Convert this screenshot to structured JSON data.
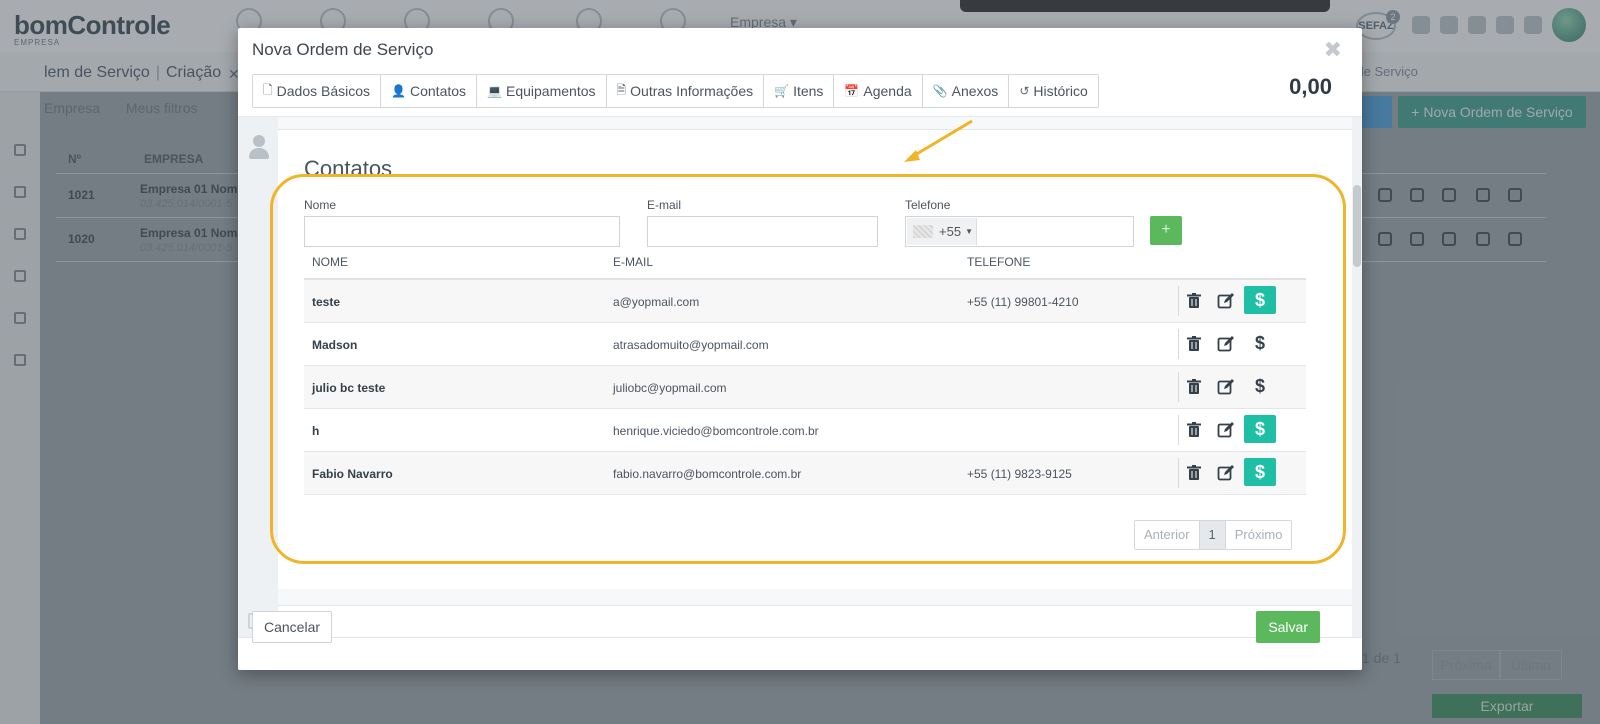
{
  "background": {
    "logo": "bomControle",
    "logo_sub": "EMPRESA",
    "empresa_menu": "Empresa",
    "sefaz": "SEFAZ",
    "sefaz_count": "2",
    "breadcrumb": [
      "lem de Serviço",
      "Criação"
    ],
    "right_crumb": "m de Serviço",
    "filters": [
      "Empresa",
      "Meus filtros"
    ],
    "table_headers": [
      "Nº",
      "EMPRESA"
    ],
    "rows": [
      {
        "num": "1021",
        "empresa": "Empresa 01 Nom",
        "cnpj": "03.425.014/0001-5"
      },
      {
        "num": "1020",
        "empresa": "Empresa 01 Nom",
        "cnpj": "03.425.014/0001-5"
      }
    ],
    "new_order_button": "Nova Ordem de Serviço",
    "pager_text": "1 de 1",
    "pager_next": "Próxima",
    "pager_last": "Último",
    "export_button": "Exportar"
  },
  "modal": {
    "title": "Nova Ordem de Serviço",
    "close_glyph": "✖",
    "total": "0,00",
    "tabs": [
      {
        "label": "Dados Básicos",
        "icon": "file-icon",
        "glyph": "🗋"
      },
      {
        "label": "Contatos",
        "icon": "user-icon",
        "glyph": "👤"
      },
      {
        "label": "Equipamentos",
        "icon": "laptop-icon",
        "glyph": "💻"
      },
      {
        "label": "Outras Informações",
        "icon": "document-icon",
        "glyph": "🗎"
      },
      {
        "label": "Itens",
        "icon": "cart-icon",
        "glyph": "🛒"
      },
      {
        "label": "Agenda",
        "icon": "calendar-icon",
        "glyph": "📅"
      },
      {
        "label": "Anexos",
        "icon": "attachment-icon",
        "glyph": "📎"
      },
      {
        "label": "Histórico",
        "icon": "history-icon",
        "glyph": "↺"
      }
    ],
    "section": {
      "title": "Contatos",
      "form": {
        "name_label": "Nome",
        "email_label": "E-mail",
        "phone_label": "Telefone",
        "name_value": "",
        "email_value": "",
        "phone_value": "",
        "phone_prefix": "+55",
        "add_glyph": "+"
      },
      "table": {
        "headers": [
          "NOME",
          "E-MAIL",
          "TELEFONE"
        ],
        "rows": [
          {
            "name": "teste",
            "email": "a@yopmail.com",
            "phone": "+55 (11) 99801-4210",
            "billing": true
          },
          {
            "name": "Madson",
            "email": "atrasadomuito@yopmail.com",
            "phone": "",
            "billing": false
          },
          {
            "name": "julio bc teste",
            "email": "juliobc@yopmail.com",
            "phone": "",
            "billing": false
          },
          {
            "name": "h",
            "email": "henrique.viciedo@bomcontrole.com.br",
            "phone": "",
            "billing": true
          },
          {
            "name": "Fabio Navarro",
            "email": "fabio.navarro@bomcontrole.com.br",
            "phone": "+55 (11) 9823-9125",
            "billing": true
          }
        ]
      },
      "pagination": {
        "prev": "Anterior",
        "page": "1",
        "next": "Próximo"
      }
    },
    "cancel_button": "Cancelar",
    "save_button": "Salvar"
  },
  "colors": {
    "accent_green": "#5cb85c",
    "teal_billing": "#1fbfa6",
    "highlight": "#f0b429"
  }
}
